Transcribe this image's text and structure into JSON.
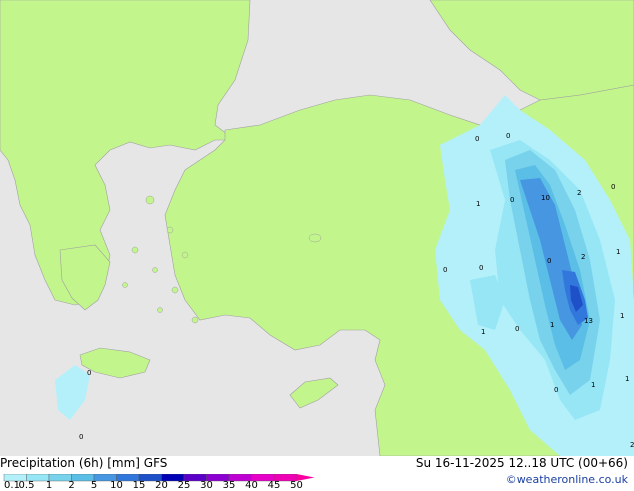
{
  "title": "Precipitation (6h) [mm] GFS",
  "valid_time": "Su 16-11-2025 12..18 UTC (00+66)",
  "credit": "©weatheronline.co.uk",
  "colors": {
    "sea": "#e6e6e6",
    "land": "#c2f58c",
    "coast": "#a0a0a0",
    "precip_scale": [
      "#b4f0fa",
      "#96e6f5",
      "#78d2eb",
      "#5abee6",
      "#4696e1",
      "#3278dc",
      "#1e50c8",
      "#0000b4",
      "#5a00c8",
      "#8c00d2",
      "#be00d2",
      "#e600c8",
      "#f000b4",
      "#fa00a0"
    ]
  },
  "colorbar": {
    "ticks": [
      "0.1",
      "0.5",
      "1",
      "2",
      "5",
      "10",
      "15",
      "20",
      "25",
      "30",
      "35",
      "40",
      "45",
      "50"
    ]
  },
  "map_labels": [
    "0",
    "0",
    "1",
    "0",
    "10",
    "2",
    "0",
    "2",
    "1",
    "0",
    "0",
    "0",
    "1",
    "0",
    "1",
    "13",
    "1",
    "1",
    "0",
    "1",
    "2",
    "0",
    "0"
  ]
}
